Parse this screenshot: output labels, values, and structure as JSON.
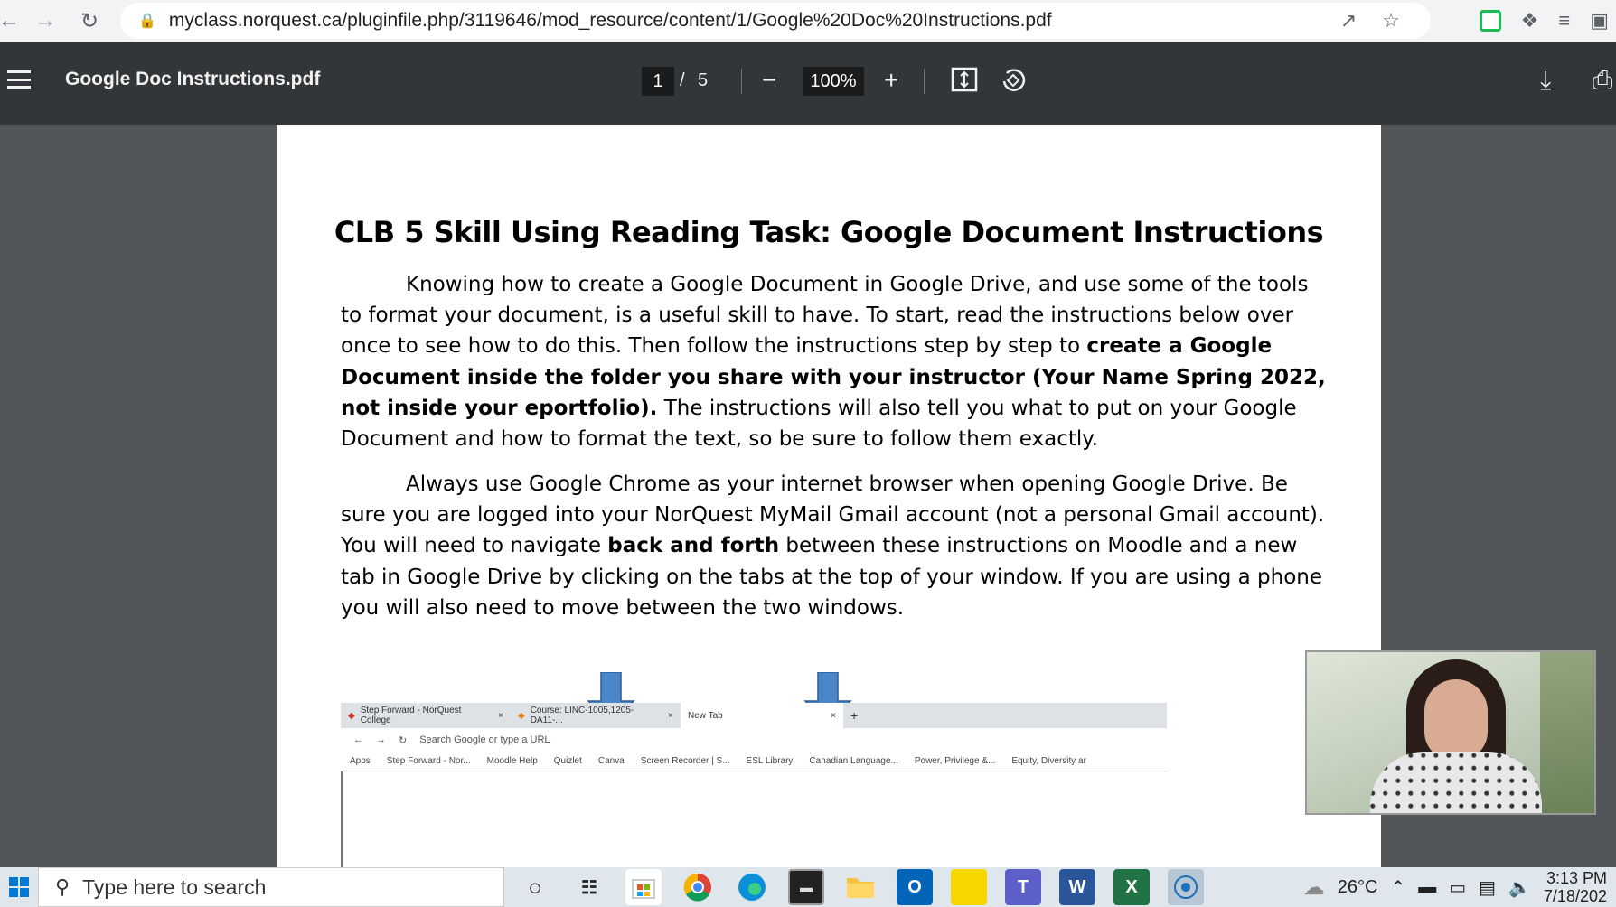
{
  "browser": {
    "url": "myclass.norquest.ca/pluginfile.php/3119646/mod_resource/content/1/Google%20Doc%20Instructions.pdf"
  },
  "pdf_toolbar": {
    "filename": "Google Doc Instructions.pdf",
    "current_page": "1",
    "page_separator": "/",
    "total_pages": "5",
    "zoom": "100%"
  },
  "document": {
    "title": "CLB 5 Skill Using Reading Task: Google Document Instructions",
    "p1_a": "Knowing how to create a Google Document in Google Drive, and use some of the tools to format your document, is a useful skill to have. To start, read the instructions below over once to see how to do this. Then follow the instructions step by step to ",
    "p1_bold": "create a Google Document inside the folder you share with your instructor (Your Name Spring 2022, not inside your eportfolio).",
    "p1_b": " The instructions will also tell you what to put on your Google Document and how to format the text, so be sure to follow them exactly.",
    "p2_a": "Always use Google Chrome as your internet browser when opening Google Drive.  Be sure you are logged into your NorQuest MyMail Gmail account (not a personal Gmail account). You will need to navigate ",
    "p2_bold": "back and forth",
    "p2_b": " between these instructions on Moodle and a new tab in Google Drive by clicking on the tabs at the top of your window. If you are using a phone you will also need to move between the two windows."
  },
  "embedded_screenshot": {
    "tabs": [
      "Step Forward - NorQuest College",
      "Course: LINC-1005,1205-DA11-...",
      "New Tab"
    ],
    "new_tab_symbol": "+",
    "close_symbol": "×",
    "address_placeholder": "Search Google or type a URL",
    "bookmarks": [
      "Apps",
      "Step Forward - Nor...",
      "Moodle Help",
      "Quizlet",
      "Canva",
      "Screen Recorder | S...",
      "ESL Library",
      "Canadian Language...",
      "Power, Privilege &...",
      "Equity, Diversity ar"
    ]
  },
  "taskbar": {
    "search_placeholder": "Type here to search",
    "weather": "26°C",
    "time": "3:13 PM",
    "date": "7/18/202"
  },
  "colors": {
    "pdf_toolbar_bg": "#323639",
    "viewer_bg": "#525659",
    "arrow_blue": "#4a86c8"
  }
}
